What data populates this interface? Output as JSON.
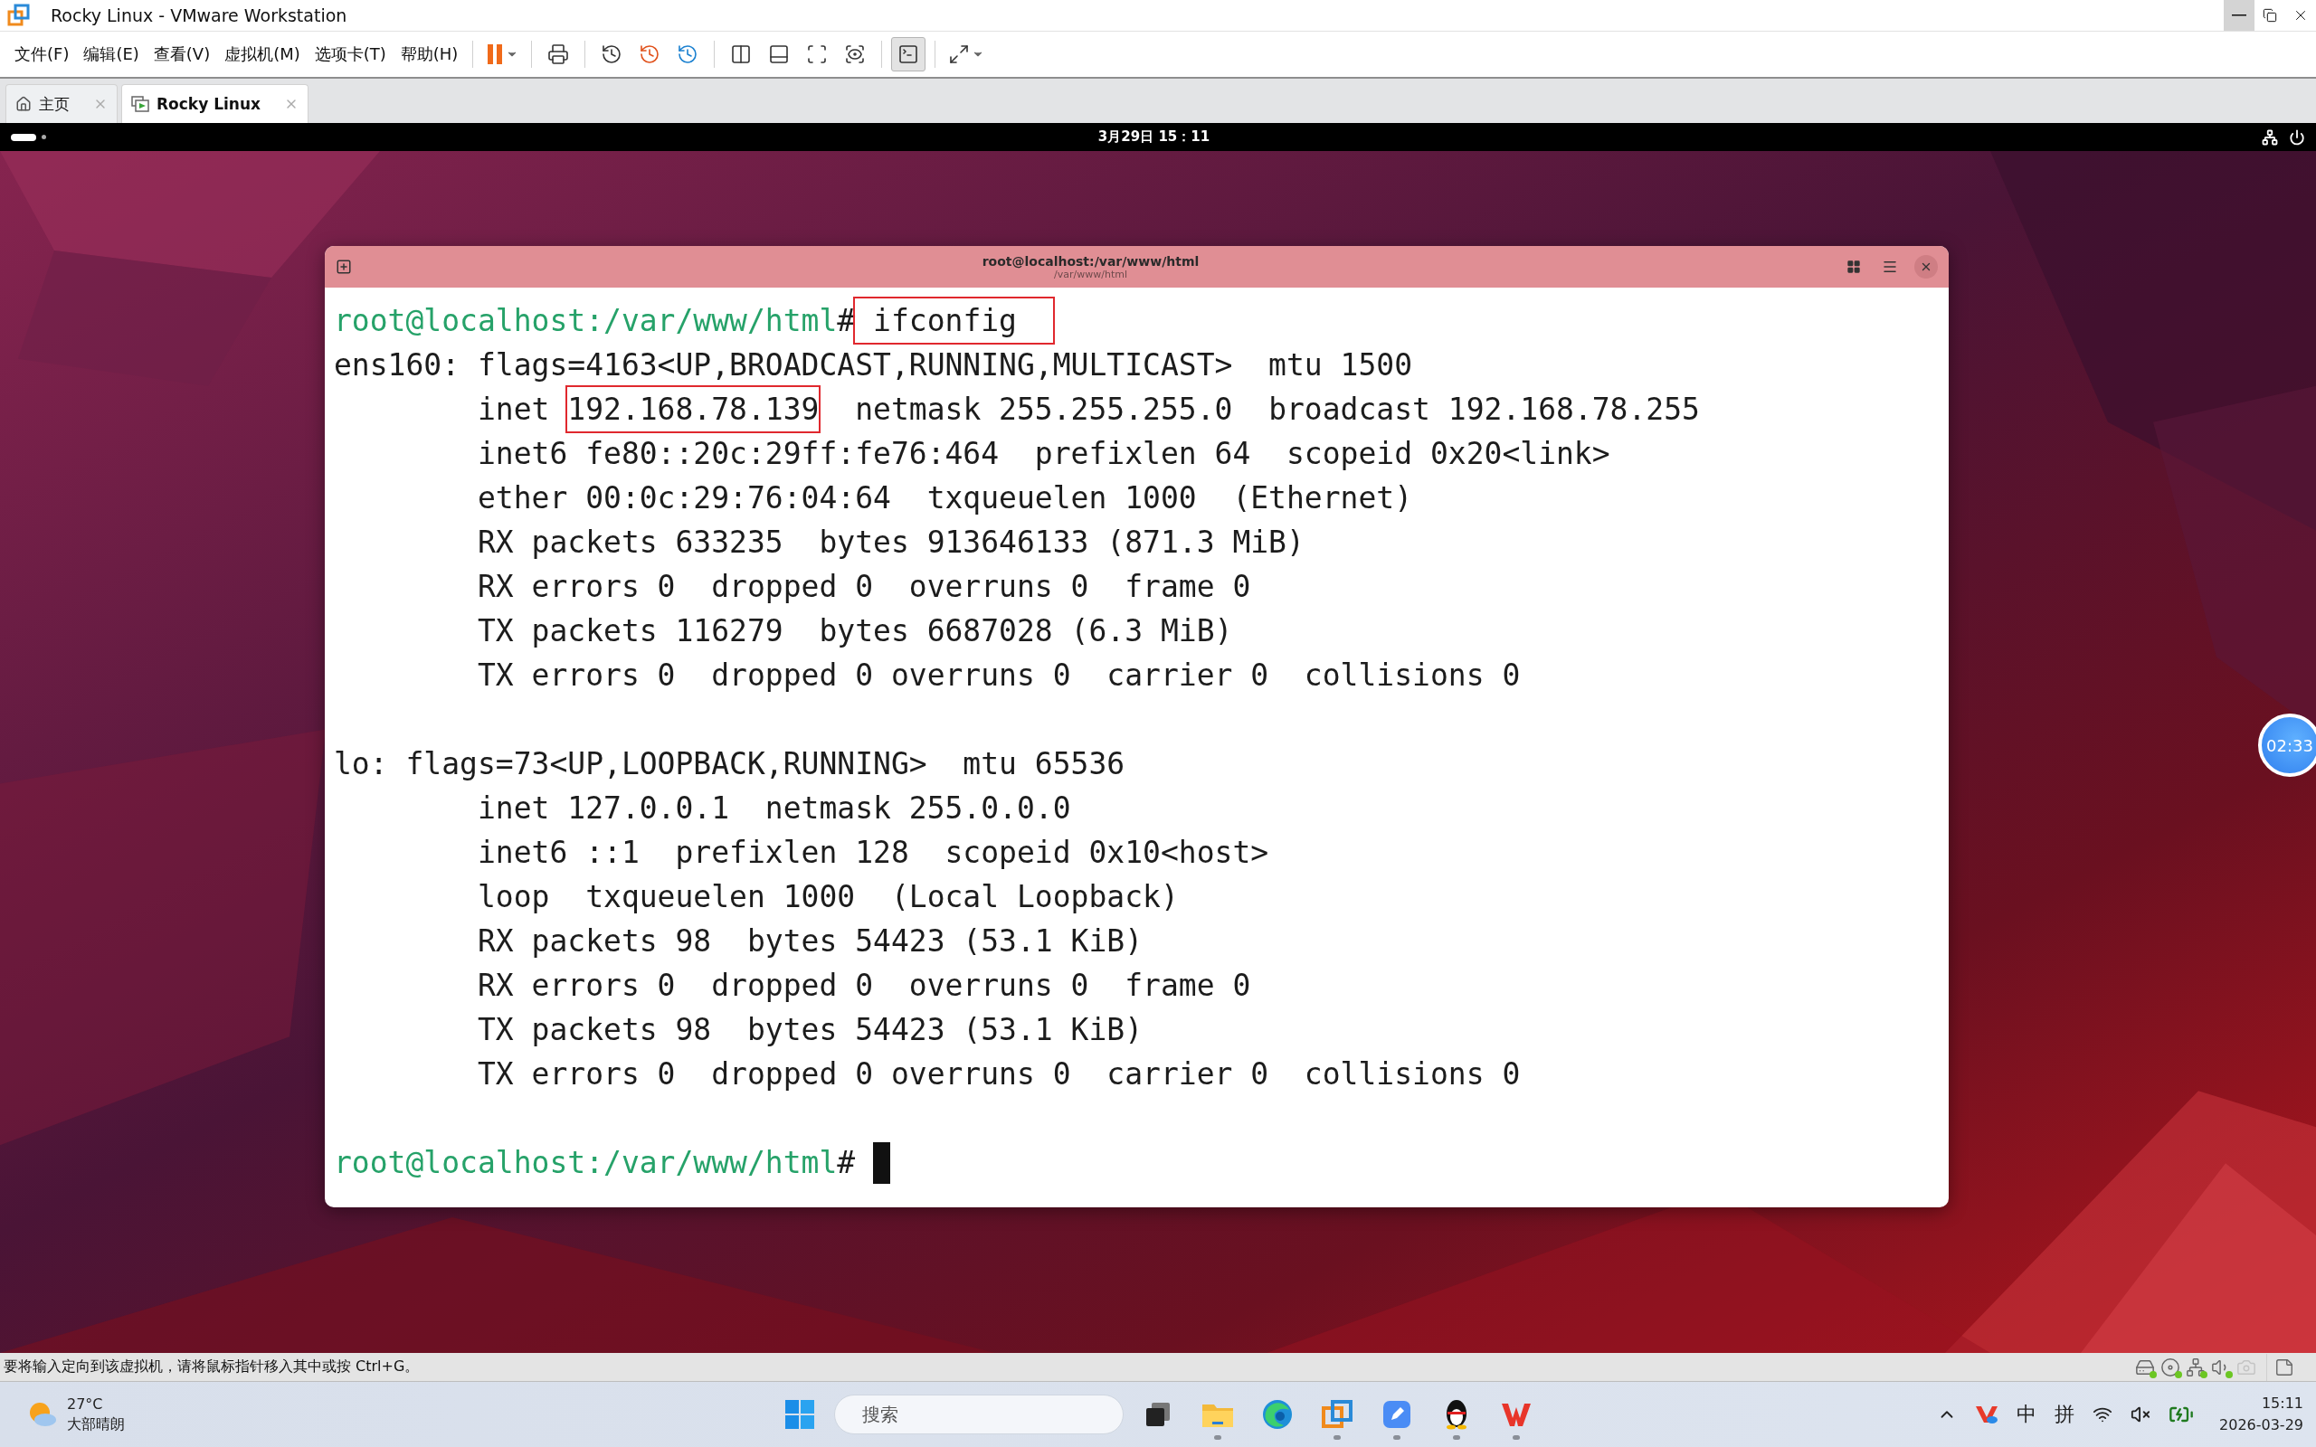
{
  "window": {
    "title": "Rocky Linux - VMware Workstation"
  },
  "menu": [
    "文件(F)",
    "编辑(E)",
    "查看(V)",
    "虚拟机(M)",
    "选项卡(T)",
    "帮助(H)"
  ],
  "toolbar": [
    {
      "kind": "pause",
      "selected": false
    },
    {
      "kind": "send-keys",
      "selected": false
    },
    {
      "kind": "snapshot-take",
      "selected": false
    },
    {
      "kind": "snapshot-revert",
      "selected": false
    },
    {
      "kind": "snapshot-manage",
      "selected": false
    },
    {
      "kind": "view-library",
      "selected": false
    },
    {
      "kind": "view-thumbnail",
      "selected": false
    },
    {
      "kind": "fullscreen",
      "selected": false
    },
    {
      "kind": "unity",
      "selected": false
    },
    {
      "kind": "console",
      "selected": true
    },
    {
      "kind": "stretch",
      "selected": false
    }
  ],
  "tabs": [
    {
      "kind": "home",
      "label": "主页",
      "selected": false
    },
    {
      "kind": "vm",
      "label": "Rocky Linux",
      "selected": true
    }
  ],
  "guest_bar": {
    "clock": "3月29日 15：11"
  },
  "terminal": {
    "title": "root@localhost:/var/www/html",
    "subtitle": "/var/www/html",
    "blocks": [
      {
        "lines": [
          {
            "segments": [
              {
                "kind": "prompt",
                "text": "root@localhost:/var/www/html"
              },
              {
                "kind": "plain",
                "text": "#"
              },
              {
                "kind": "boxed",
                "text": " ifconfig  "
              }
            ]
          },
          {
            "segments": [
              {
                "kind": "plain",
                "text": "ens160: flags=4163<UP,BROADCAST,RUNNING,MULTICAST>  mtu 1500"
              }
            ]
          },
          {
            "segments": [
              {
                "kind": "plain",
                "text": "        inet "
              },
              {
                "kind": "boxed",
                "text": "192.168.78.139"
              },
              {
                "kind": "plain",
                "text": "  netmask 255.255.255.0  broadcast 192.168.78.255"
              }
            ]
          },
          {
            "segments": [
              {
                "kind": "plain",
                "text": "        inet6 fe80::20c:29ff:fe76:464  prefixlen 64  scopeid 0x20<link>"
              }
            ]
          },
          {
            "segments": [
              {
                "kind": "plain",
                "text": "        ether 00:0c:29:76:04:64  txqueuelen 1000  (Ethernet)"
              }
            ]
          },
          {
            "segments": [
              {
                "kind": "plain",
                "text": "        RX packets 633235  bytes 913646133 (871.3 MiB)"
              }
            ]
          },
          {
            "segments": [
              {
                "kind": "plain",
                "text": "        RX errors 0  dropped 0  overruns 0  frame 0"
              }
            ]
          },
          {
            "segments": [
              {
                "kind": "plain",
                "text": "        TX packets 116279  bytes 6687028 (6.3 MiB)"
              }
            ]
          },
          {
            "segments": [
              {
                "kind": "plain",
                "text": "        TX errors 0  dropped 0 overruns 0  carrier 0  collisions 0"
              }
            ]
          }
        ]
      },
      {
        "lines": [
          {
            "segments": [
              {
                "kind": "plain",
                "text": "lo: flags=73<UP,LOOPBACK,RUNNING>  mtu 65536"
              }
            ]
          },
          {
            "segments": [
              {
                "kind": "plain",
                "text": "        inet 127.0.0.1  netmask 255.0.0.0"
              }
            ]
          },
          {
            "segments": [
              {
                "kind": "plain",
                "text": "        inet6 ::1  prefixlen 128  scopeid 0x10<host>"
              }
            ]
          },
          {
            "segments": [
              {
                "kind": "plain",
                "text": "        loop  txqueuelen 1000  (Local Loopback)"
              }
            ]
          },
          {
            "segments": [
              {
                "kind": "plain",
                "text": "        RX packets 98  bytes 54423 (53.1 KiB)"
              }
            ]
          },
          {
            "segments": [
              {
                "kind": "plain",
                "text": "        RX errors 0  dropped 0  overruns 0  frame 0"
              }
            ]
          },
          {
            "segments": [
              {
                "kind": "plain",
                "text": "        TX packets 98  bytes 54423 (53.1 KiB)"
              }
            ]
          },
          {
            "segments": [
              {
                "kind": "plain",
                "text": "        TX errors 0  dropped 0 overruns 0  carrier 0  collisions 0"
              }
            ]
          }
        ]
      },
      {
        "lines": [
          {
            "segments": [
              {
                "kind": "prompt",
                "text": "root@localhost:/var/www/html"
              },
              {
                "kind": "plain",
                "text": "# "
              }
            ],
            "cursor": true
          }
        ]
      }
    ]
  },
  "timer": {
    "text": "02:33"
  },
  "status_bar": {
    "message": "要将输入定向到该虚拟机，请将鼠标指针移入其中或按 Ctrl+G。",
    "devices": [
      {
        "kind": "disk",
        "connected": true
      },
      {
        "kind": "cd",
        "connected": true
      },
      {
        "kind": "network",
        "connected": true
      },
      {
        "kind": "sound",
        "connected": true
      },
      {
        "kind": "camera",
        "connected": false
      }
    ]
  },
  "taskbar": {
    "weather": {
      "temp": "27°C",
      "desc": "大部晴朗"
    },
    "search": {
      "placeholder": "搜索"
    },
    "apps": [
      {
        "kind": "task-view",
        "running": false
      },
      {
        "kind": "files",
        "running": true
      },
      {
        "kind": "edge",
        "running": false
      },
      {
        "kind": "vmware",
        "running": true
      },
      {
        "kind": "notes",
        "running": true
      },
      {
        "kind": "penguin",
        "running": true
      },
      {
        "kind": "wps",
        "running": true
      }
    ],
    "tray": {
      "ime_lang": "中",
      "ime_mode": "拼",
      "time": "15:11",
      "date": "2026-03-29"
    }
  }
}
